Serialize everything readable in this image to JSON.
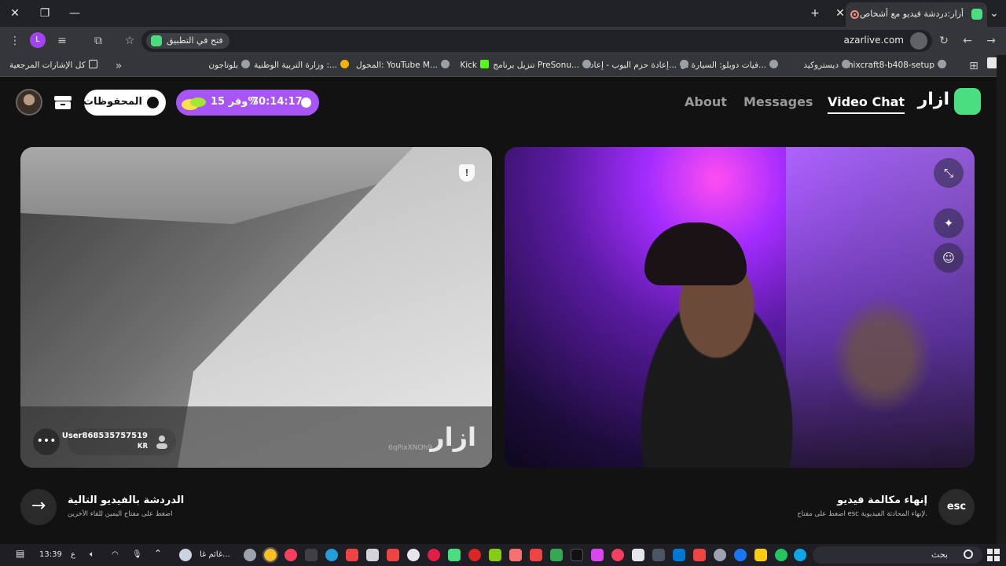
{
  "browser": {
    "tab_title": "أزار:دردشة فيديو مع أشخاص",
    "url": "azarlive.com",
    "open_in_app": "فتح في التطبيق"
  },
  "bookmarks": [
    {
      "label": "mixcraft8-b408-setup"
    },
    {
      "label": "ديستروكيد"
    },
    {
      "label": "فيات دوبلو: السيارة ال..."
    },
    {
      "label": "إعادة حزم البوب - إعاد..."
    },
    {
      "label": "تنزيل برنامج PreSonu..."
    },
    {
      "label": "Kick"
    },
    {
      "label": "المحول: YouTube M..."
    },
    {
      "label": "وزارة التربية الوطنية :..."
    },
    {
      "label": "بلوتاجون"
    },
    {
      "label": "كل الإشارات المرجعية"
    }
  ],
  "nav": {
    "brand": "ازار",
    "video_chat": "Video Chat",
    "messages": "Messages",
    "about": "About"
  },
  "promo": {
    "timer": "70:14:17",
    "save": "وفر 15%"
  },
  "saved": {
    "label": "المحفوظات"
  },
  "remote": {
    "watermark": "ازار",
    "watermark_id": "6qPixXNOh9",
    "username": "User868535757519",
    "country": "KR"
  },
  "actions": {
    "next_title": "الدردشة بالفيديو التالية",
    "next_sub": "اضغط على مفتاح اليمين للقاء الآخرين",
    "end_key": "esc",
    "end_title": "إنهاء مكالمة فيديو",
    "end_sub": "اضغط على مفتاح esc لإنهاء المحادثة الفيديوية."
  },
  "taskbar": {
    "search": "بحث",
    "weather": "غائم غا...",
    "time": "13:39",
    "lang": "ع"
  }
}
